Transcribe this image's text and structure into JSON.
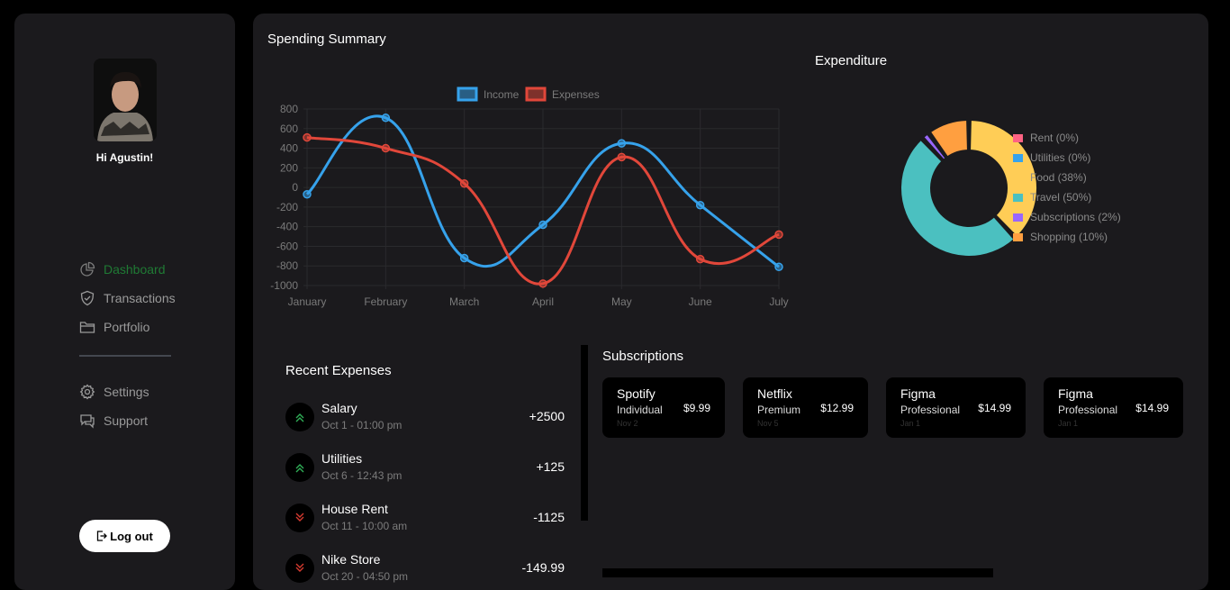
{
  "sidebar": {
    "greeting": "Hi Agustin!",
    "nav": [
      {
        "label": "Dashboard",
        "icon": "pie-chart-icon"
      },
      {
        "label": "Transactions",
        "icon": "shield-check-icon"
      },
      {
        "label": "Portfolio",
        "icon": "folder-icon"
      }
    ],
    "nav2": [
      {
        "label": "Settings",
        "icon": "gear-icon"
      },
      {
        "label": "Support",
        "icon": "chat-icon"
      }
    ],
    "logout_label": "Log out"
  },
  "spending": {
    "title": "Spending Summary"
  },
  "expenditure": {
    "title": "Expenditure"
  },
  "recent": {
    "title": "Recent Expenses",
    "items": [
      {
        "name": "Salary",
        "date": "Oct 1 - 01:00 pm",
        "amount": "+2500",
        "direction": "up"
      },
      {
        "name": "Utilities",
        "date": "Oct 6 - 12:43 pm",
        "amount": "+125",
        "direction": "up"
      },
      {
        "name": "House Rent",
        "date": "Oct 11 - 10:00 am",
        "amount": "-1125",
        "direction": "down"
      },
      {
        "name": "Nike Store",
        "date": "Oct 20 - 04:50 pm",
        "amount": "-149.99",
        "direction": "down"
      }
    ]
  },
  "subscriptions": {
    "title": "Subscriptions",
    "items": [
      {
        "name": "Spotify",
        "plan": "Individual",
        "price": "$9.99",
        "date": "Nov 2"
      },
      {
        "name": "Netflix",
        "plan": "Premium",
        "price": "$12.99",
        "date": "Nov 5"
      },
      {
        "name": "Figma",
        "plan": "Professional",
        "price": "$14.99",
        "date": "Jan 1"
      },
      {
        "name": "Figma",
        "plan": "Professional",
        "price": "$14.99",
        "date": "Jan 1"
      }
    ]
  },
  "colors": {
    "income": "#36a2eb",
    "expenses": "#e1473a",
    "active_nav": "#1f7a34"
  },
  "chart_data": [
    {
      "type": "line",
      "categories": [
        "January",
        "February",
        "March",
        "April",
        "May",
        "June",
        "July"
      ],
      "series": [
        {
          "name": "Income",
          "values": [
            -70,
            710,
            -720,
            -380,
            450,
            -180,
            -810
          ],
          "color": "#36a2eb"
        },
        {
          "name": "Expenses",
          "values": [
            510,
            400,
            40,
            -980,
            310,
            -730,
            -480
          ],
          "color": "#e1473a"
        }
      ],
      "ylim": [
        -1000,
        800
      ],
      "yticks": [
        800,
        600,
        400,
        200,
        0,
        -200,
        -400,
        -600,
        -800,
        -1000
      ],
      "legend": "top",
      "grid": true
    },
    {
      "type": "pie",
      "labels": [
        "Rent (0%)",
        "Utilities (0%)",
        "Food (38%)",
        "Travel (50%)",
        "Subscriptions (2%)",
        "Shopping (10%)"
      ],
      "values": [
        0,
        0,
        38,
        50,
        2,
        10
      ],
      "colors": [
        "#ff6384",
        "#36a2eb",
        "#ffcd56",
        "#4bc0c0",
        "#9966ff",
        "#ff9f40"
      ],
      "legend": "right"
    }
  ]
}
